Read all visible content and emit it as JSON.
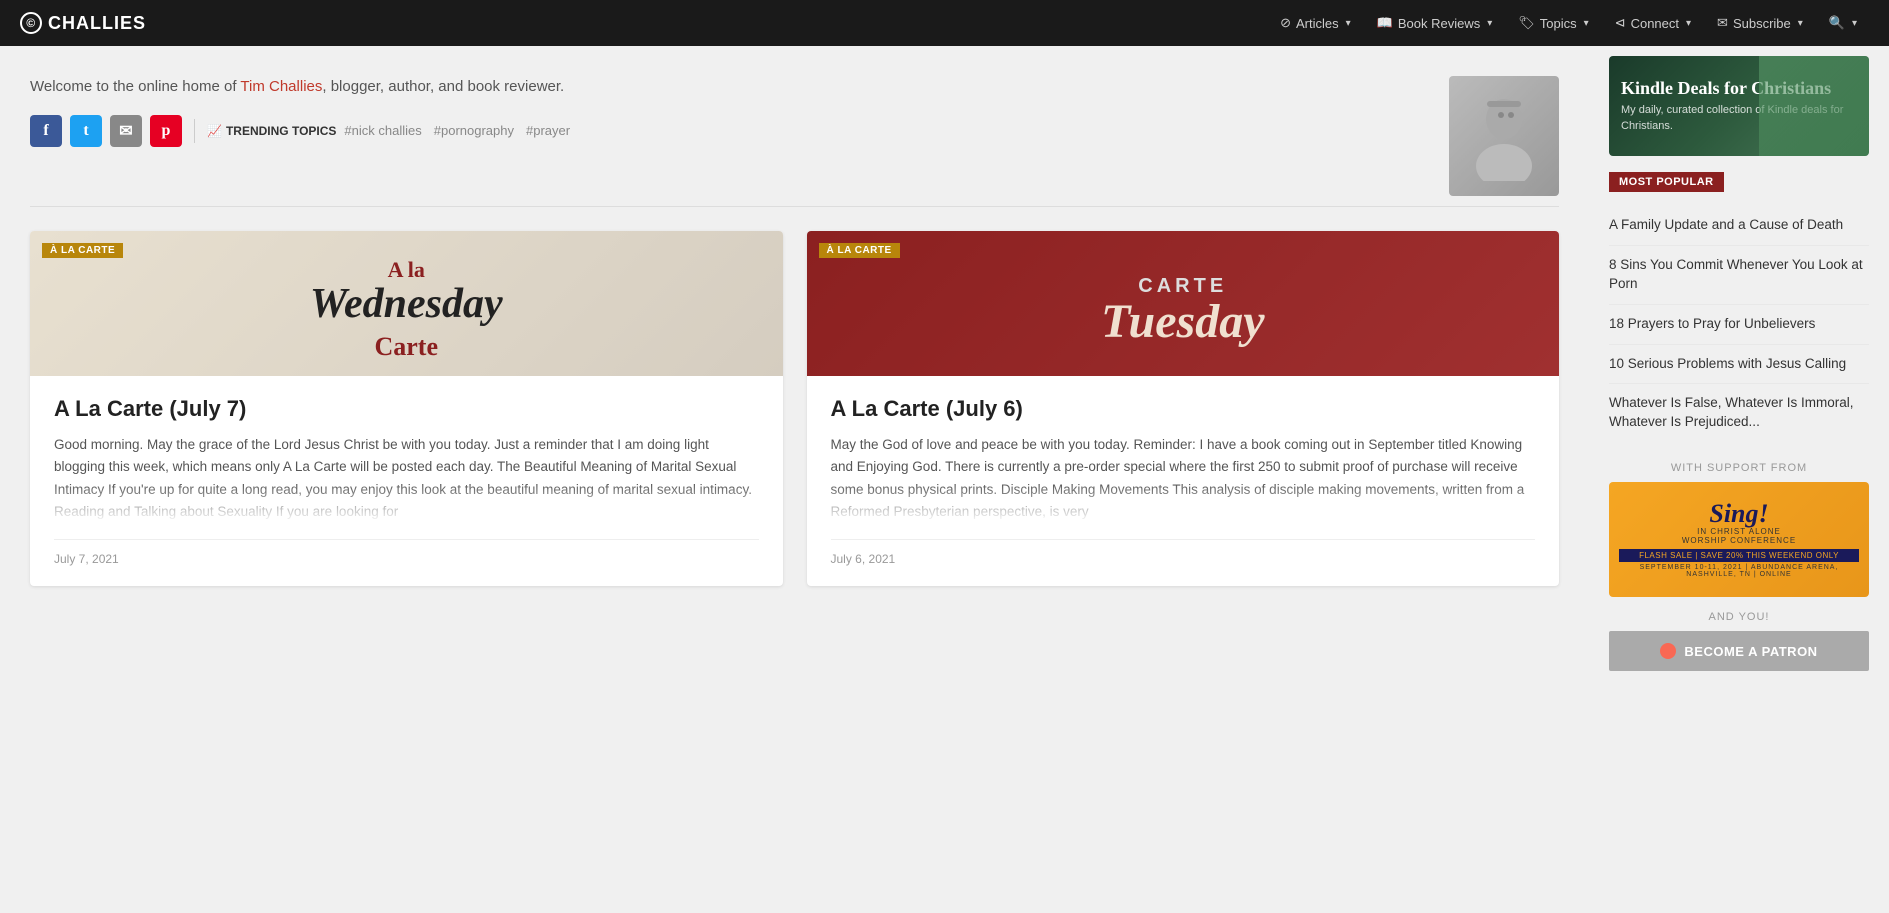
{
  "site": {
    "logo": "CHALLIES",
    "logo_icon": "©"
  },
  "nav": {
    "items": [
      {
        "label": "Articles",
        "icon": "circle-slash",
        "has_dropdown": true
      },
      {
        "label": "Book Reviews",
        "icon": "book",
        "has_dropdown": true
      },
      {
        "label": "Topics",
        "icon": "tag",
        "has_dropdown": true
      },
      {
        "label": "Connect",
        "icon": "share",
        "has_dropdown": true
      },
      {
        "label": "Subscribe",
        "icon": "envelope",
        "has_dropdown": true
      },
      {
        "label": "",
        "icon": "search",
        "has_dropdown": true
      }
    ]
  },
  "header": {
    "description_pre": "Welcome to the online home of ",
    "author_link": "Tim Challies",
    "description_post": ", blogger, author, and book reviewer."
  },
  "social": {
    "icons": [
      {
        "name": "facebook",
        "label": "f",
        "class": "social-facebook"
      },
      {
        "name": "twitter",
        "label": "t",
        "class": "social-twitter"
      },
      {
        "name": "email",
        "label": "✉",
        "class": "social-email"
      },
      {
        "name": "pinterest",
        "label": "p",
        "class": "social-pinterest"
      }
    ]
  },
  "trending": {
    "label": "TRENDING TOPICS",
    "tags": [
      "#nick challies",
      "#pornography",
      "#prayer"
    ]
  },
  "articles": [
    {
      "id": "july7",
      "badge": "À LA CARTE",
      "title": "A La Carte (July 7)",
      "image_type": "wednesday",
      "excerpt": "Good morning. May the grace of the Lord Jesus Christ be with you today. Just a reminder that I am doing light blogging this week, which means only A La Carte will be posted each day. The Beautiful Meaning of Marital Sexual Intimacy If you're up for quite a long read, you may enjoy this look at the beautiful meaning of marital sexual intimacy. Reading and Talking about Sexuality If you are looking for",
      "date": "July 7, 2021"
    },
    {
      "id": "july6",
      "badge": "À LA CARTE",
      "title": "A La Carte (July 6)",
      "image_type": "tuesday",
      "excerpt": "May the God of love and peace be with you today. Reminder: I have a book coming out in September titled Knowing and Enjoying God. There is currently a pre-order special where the first 250 to submit proof of purchase will receive some bonus physical prints. Disciple Making Movements This analysis of disciple making movements, written from a Reformed Presbyterian perspective, is very",
      "date": "July 6, 2021"
    }
  ],
  "sidebar": {
    "kindle": {
      "title": "Kindle Deals for Christians",
      "subtitle": "My daily, curated collection of Kindle deals for Christians."
    },
    "most_popular_label": "MOST POPULAR",
    "popular_items": [
      {
        "text": "A Family Update and a Cause of Death"
      },
      {
        "text": "8 Sins You Commit Whenever You Look at Porn"
      },
      {
        "text": "18 Prayers to Pray for Unbelievers"
      },
      {
        "text": "10 Serious Problems with Jesus Calling"
      },
      {
        "text": "Whatever Is False, Whatever Is Immoral, Whatever Is Prejudiced..."
      }
    ],
    "support_label": "WITH SUPPORT FROM",
    "sing_banner": {
      "title": "Sing!",
      "subtitle": "IN CHRIST ALONE",
      "sub2": "WORSHIP CONFERENCE",
      "flash": "FLASH SALE | SAVE 20% THIS WEEKEND ONLY",
      "sub3": "SEPTEMBER 10-11, 2021 | ABUNDANCE ARENA, NASHVILLE, TN | ONLINE"
    },
    "and_you_label": "AND YOU!",
    "patron_button": "BECOME A PATRON"
  }
}
